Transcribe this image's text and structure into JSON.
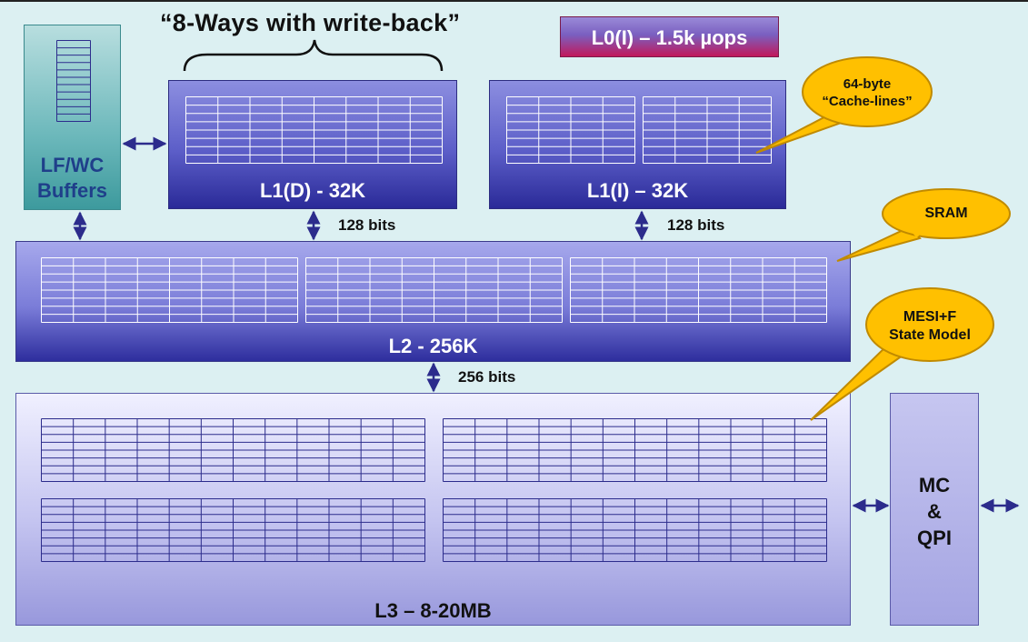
{
  "title": "“8-Ways with write-back”",
  "l0_label": "L0(I) – 1.5k µops",
  "lfwc": {
    "line1": "LF/WC",
    "line2": "Buffers"
  },
  "l1d_label": "L1(D) - 32K",
  "l1i_label": "L1(I) – 32K",
  "l2_label": "L2 - 256K",
  "l3_label": "L3 – 8-20MB",
  "mc": {
    "line1": "MC",
    "line2": "&",
    "line3": "QPI"
  },
  "bus": {
    "l1d_l2": "128 bits",
    "l1i_l2": "128 bits",
    "l2_l3": "256 bits"
  },
  "callouts": {
    "cacheline": {
      "line1": "64-byte",
      "line2": "“Cache-lines”"
    },
    "sram": {
      "line1": "SRAM"
    },
    "mesi": {
      "line1": "MESI+F",
      "line2": "State Model"
    }
  },
  "colors": {
    "background": "#dcf0f2",
    "arrow": "#2c2c8c",
    "callout_fill": "#ffc000",
    "callout_stroke": "#c08a00",
    "l0_bottom": "#c2185b"
  }
}
